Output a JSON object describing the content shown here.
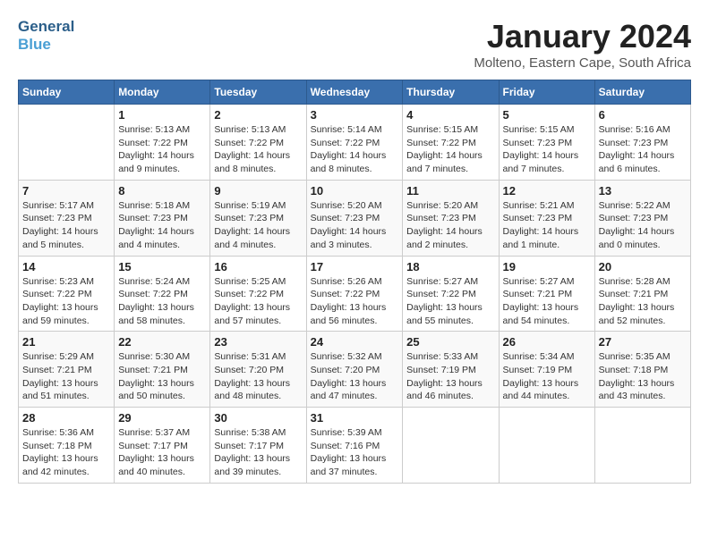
{
  "header": {
    "logo_line1": "General",
    "logo_line2": "Blue",
    "month": "January 2024",
    "location": "Molteno, Eastern Cape, South Africa"
  },
  "weekdays": [
    "Sunday",
    "Monday",
    "Tuesday",
    "Wednesday",
    "Thursday",
    "Friday",
    "Saturday"
  ],
  "weeks": [
    [
      {
        "day": "",
        "info": ""
      },
      {
        "day": "1",
        "info": "Sunrise: 5:13 AM\nSunset: 7:22 PM\nDaylight: 14 hours\nand 9 minutes."
      },
      {
        "day": "2",
        "info": "Sunrise: 5:13 AM\nSunset: 7:22 PM\nDaylight: 14 hours\nand 8 minutes."
      },
      {
        "day": "3",
        "info": "Sunrise: 5:14 AM\nSunset: 7:22 PM\nDaylight: 14 hours\nand 8 minutes."
      },
      {
        "day": "4",
        "info": "Sunrise: 5:15 AM\nSunset: 7:22 PM\nDaylight: 14 hours\nand 7 minutes."
      },
      {
        "day": "5",
        "info": "Sunrise: 5:15 AM\nSunset: 7:23 PM\nDaylight: 14 hours\nand 7 minutes."
      },
      {
        "day": "6",
        "info": "Sunrise: 5:16 AM\nSunset: 7:23 PM\nDaylight: 14 hours\nand 6 minutes."
      }
    ],
    [
      {
        "day": "7",
        "info": "Sunrise: 5:17 AM\nSunset: 7:23 PM\nDaylight: 14 hours\nand 5 minutes."
      },
      {
        "day": "8",
        "info": "Sunrise: 5:18 AM\nSunset: 7:23 PM\nDaylight: 14 hours\nand 4 minutes."
      },
      {
        "day": "9",
        "info": "Sunrise: 5:19 AM\nSunset: 7:23 PM\nDaylight: 14 hours\nand 4 minutes."
      },
      {
        "day": "10",
        "info": "Sunrise: 5:20 AM\nSunset: 7:23 PM\nDaylight: 14 hours\nand 3 minutes."
      },
      {
        "day": "11",
        "info": "Sunrise: 5:20 AM\nSunset: 7:23 PM\nDaylight: 14 hours\nand 2 minutes."
      },
      {
        "day": "12",
        "info": "Sunrise: 5:21 AM\nSunset: 7:23 PM\nDaylight: 14 hours\nand 1 minute."
      },
      {
        "day": "13",
        "info": "Sunrise: 5:22 AM\nSunset: 7:23 PM\nDaylight: 14 hours\nand 0 minutes."
      }
    ],
    [
      {
        "day": "14",
        "info": "Sunrise: 5:23 AM\nSunset: 7:22 PM\nDaylight: 13 hours\nand 59 minutes."
      },
      {
        "day": "15",
        "info": "Sunrise: 5:24 AM\nSunset: 7:22 PM\nDaylight: 13 hours\nand 58 minutes."
      },
      {
        "day": "16",
        "info": "Sunrise: 5:25 AM\nSunset: 7:22 PM\nDaylight: 13 hours\nand 57 minutes."
      },
      {
        "day": "17",
        "info": "Sunrise: 5:26 AM\nSunset: 7:22 PM\nDaylight: 13 hours\nand 56 minutes."
      },
      {
        "day": "18",
        "info": "Sunrise: 5:27 AM\nSunset: 7:22 PM\nDaylight: 13 hours\nand 55 minutes."
      },
      {
        "day": "19",
        "info": "Sunrise: 5:27 AM\nSunset: 7:21 PM\nDaylight: 13 hours\nand 54 minutes."
      },
      {
        "day": "20",
        "info": "Sunrise: 5:28 AM\nSunset: 7:21 PM\nDaylight: 13 hours\nand 52 minutes."
      }
    ],
    [
      {
        "day": "21",
        "info": "Sunrise: 5:29 AM\nSunset: 7:21 PM\nDaylight: 13 hours\nand 51 minutes."
      },
      {
        "day": "22",
        "info": "Sunrise: 5:30 AM\nSunset: 7:21 PM\nDaylight: 13 hours\nand 50 minutes."
      },
      {
        "day": "23",
        "info": "Sunrise: 5:31 AM\nSunset: 7:20 PM\nDaylight: 13 hours\nand 48 minutes."
      },
      {
        "day": "24",
        "info": "Sunrise: 5:32 AM\nSunset: 7:20 PM\nDaylight: 13 hours\nand 47 minutes."
      },
      {
        "day": "25",
        "info": "Sunrise: 5:33 AM\nSunset: 7:19 PM\nDaylight: 13 hours\nand 46 minutes."
      },
      {
        "day": "26",
        "info": "Sunrise: 5:34 AM\nSunset: 7:19 PM\nDaylight: 13 hours\nand 44 minutes."
      },
      {
        "day": "27",
        "info": "Sunrise: 5:35 AM\nSunset: 7:18 PM\nDaylight: 13 hours\nand 43 minutes."
      }
    ],
    [
      {
        "day": "28",
        "info": "Sunrise: 5:36 AM\nSunset: 7:18 PM\nDaylight: 13 hours\nand 42 minutes."
      },
      {
        "day": "29",
        "info": "Sunrise: 5:37 AM\nSunset: 7:17 PM\nDaylight: 13 hours\nand 40 minutes."
      },
      {
        "day": "30",
        "info": "Sunrise: 5:38 AM\nSunset: 7:17 PM\nDaylight: 13 hours\nand 39 minutes."
      },
      {
        "day": "31",
        "info": "Sunrise: 5:39 AM\nSunset: 7:16 PM\nDaylight: 13 hours\nand 37 minutes."
      },
      {
        "day": "",
        "info": ""
      },
      {
        "day": "",
        "info": ""
      },
      {
        "day": "",
        "info": ""
      }
    ]
  ]
}
